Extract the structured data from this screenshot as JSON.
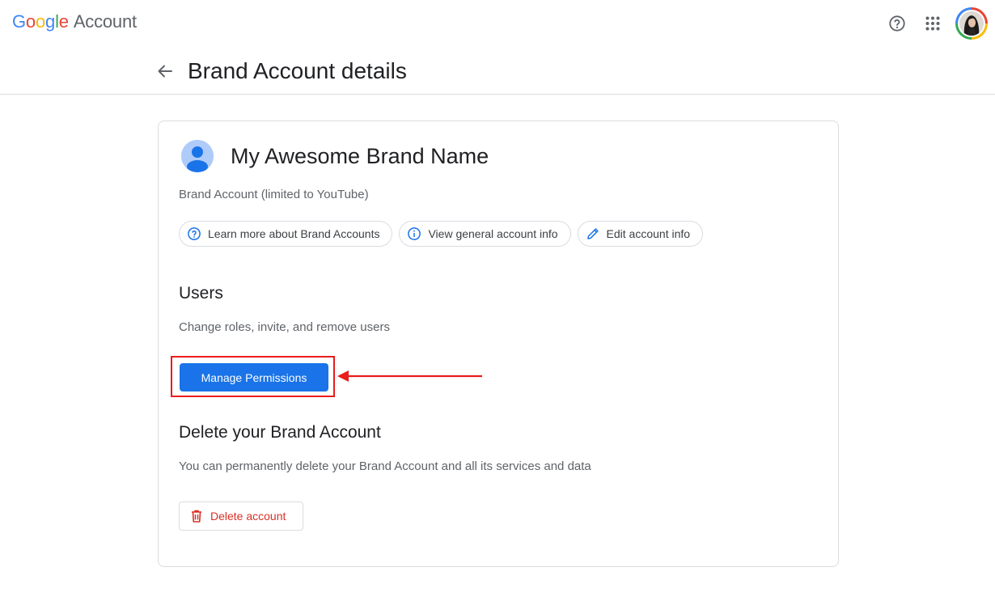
{
  "header": {
    "logo_letters": [
      "G",
      "o",
      "o",
      "g",
      "l",
      "e"
    ],
    "logo_colors": [
      "#4285f4",
      "#ea4335",
      "#fbbc04",
      "#4285f4",
      "#34a853",
      "#ea4335"
    ],
    "product_name": "Account",
    "icons": [
      "help-icon",
      "apps-grid-icon",
      "profile-avatar"
    ]
  },
  "page": {
    "title": "Brand Account details",
    "back_icon": "arrow-back-icon"
  },
  "brand": {
    "name": "My Awesome Brand Name",
    "subtitle": "Brand Account (limited to YouTube)"
  },
  "chips": [
    {
      "label": "Learn more about Brand Accounts",
      "icon": "help-circle-icon"
    },
    {
      "label": "View general account info",
      "icon": "info-icon"
    },
    {
      "label": "Edit account info",
      "icon": "pencil-icon"
    }
  ],
  "users": {
    "title": "Users",
    "description": "Change roles, invite, and remove users",
    "button_label": "Manage Permissions"
  },
  "delete": {
    "title": "Delete your Brand Account",
    "description": "You can permanently delete your Brand Account and all its services and data",
    "button_label": "Delete account",
    "button_icon": "trash-icon"
  },
  "colors": {
    "primary": "#1a73e8",
    "danger": "#d93025",
    "annotation": "#ea1c1c",
    "border": "#dadce0"
  }
}
